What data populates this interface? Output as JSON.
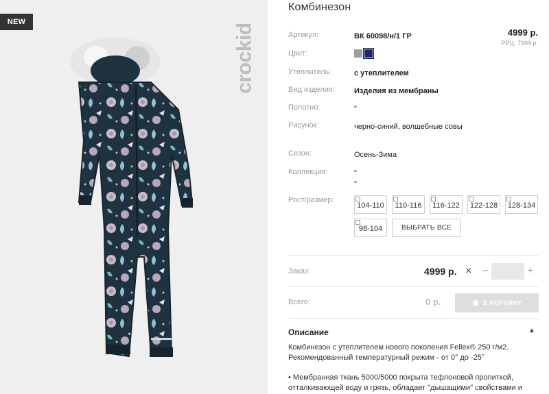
{
  "badge": "NEW",
  "brand": "crockid",
  "product": {
    "title": "Комбинезон",
    "price": "4999 р.",
    "rrp": "РРЦ: 7999 р."
  },
  "specs": [
    {
      "label": "Артикул:",
      "value": "ВК 60098/н/1 ГР"
    },
    {
      "label": "Цвет:",
      "value": ""
    },
    {
      "label": "Утеплитель:",
      "value": "с утеплителем"
    },
    {
      "label": "Вид изделия:",
      "value": "Изделия из мембраны"
    },
    {
      "label": "Полотно:",
      "value": "\""
    },
    {
      "label": "Рисунок:",
      "value": "черно-синий, волшебные совы"
    },
    {
      "label": "Сезон:",
      "value": "Осень-Зима"
    },
    {
      "label": "Коллекция:",
      "value": "\" \""
    }
  ],
  "colors": {
    "gray": "#9e9e9e",
    "navy": "#1a237e"
  },
  "size_label": "Рост/размер:",
  "sizes": [
    "104-110",
    "110-116",
    "116-122",
    "122-128",
    "128-134",
    "98-104"
  ],
  "select_all": "ВЫБРАТЬ ВСЕ",
  "order": {
    "label": "Заказ:",
    "price": "4999 р.",
    "times": "×",
    "minus": "–",
    "plus": "+",
    "qty_value": ""
  },
  "total": {
    "label": "Всего:",
    "value": "0 р.",
    "cart_button": "В КОРЗИНУ"
  },
  "description": {
    "heading": "Описание",
    "arrow": "▲",
    "text": "Комбинезон с утеплителем нового поколения Fellex® 250 г/м2. Рекомендованный температурный режим - от 0° до -25°",
    "bullet": "• Мембранная ткань 5000/5000 покрыта тефлоновой пропиткой, отталкивающей воду и грязь, обладает \"дышащими\" свойствами и"
  }
}
